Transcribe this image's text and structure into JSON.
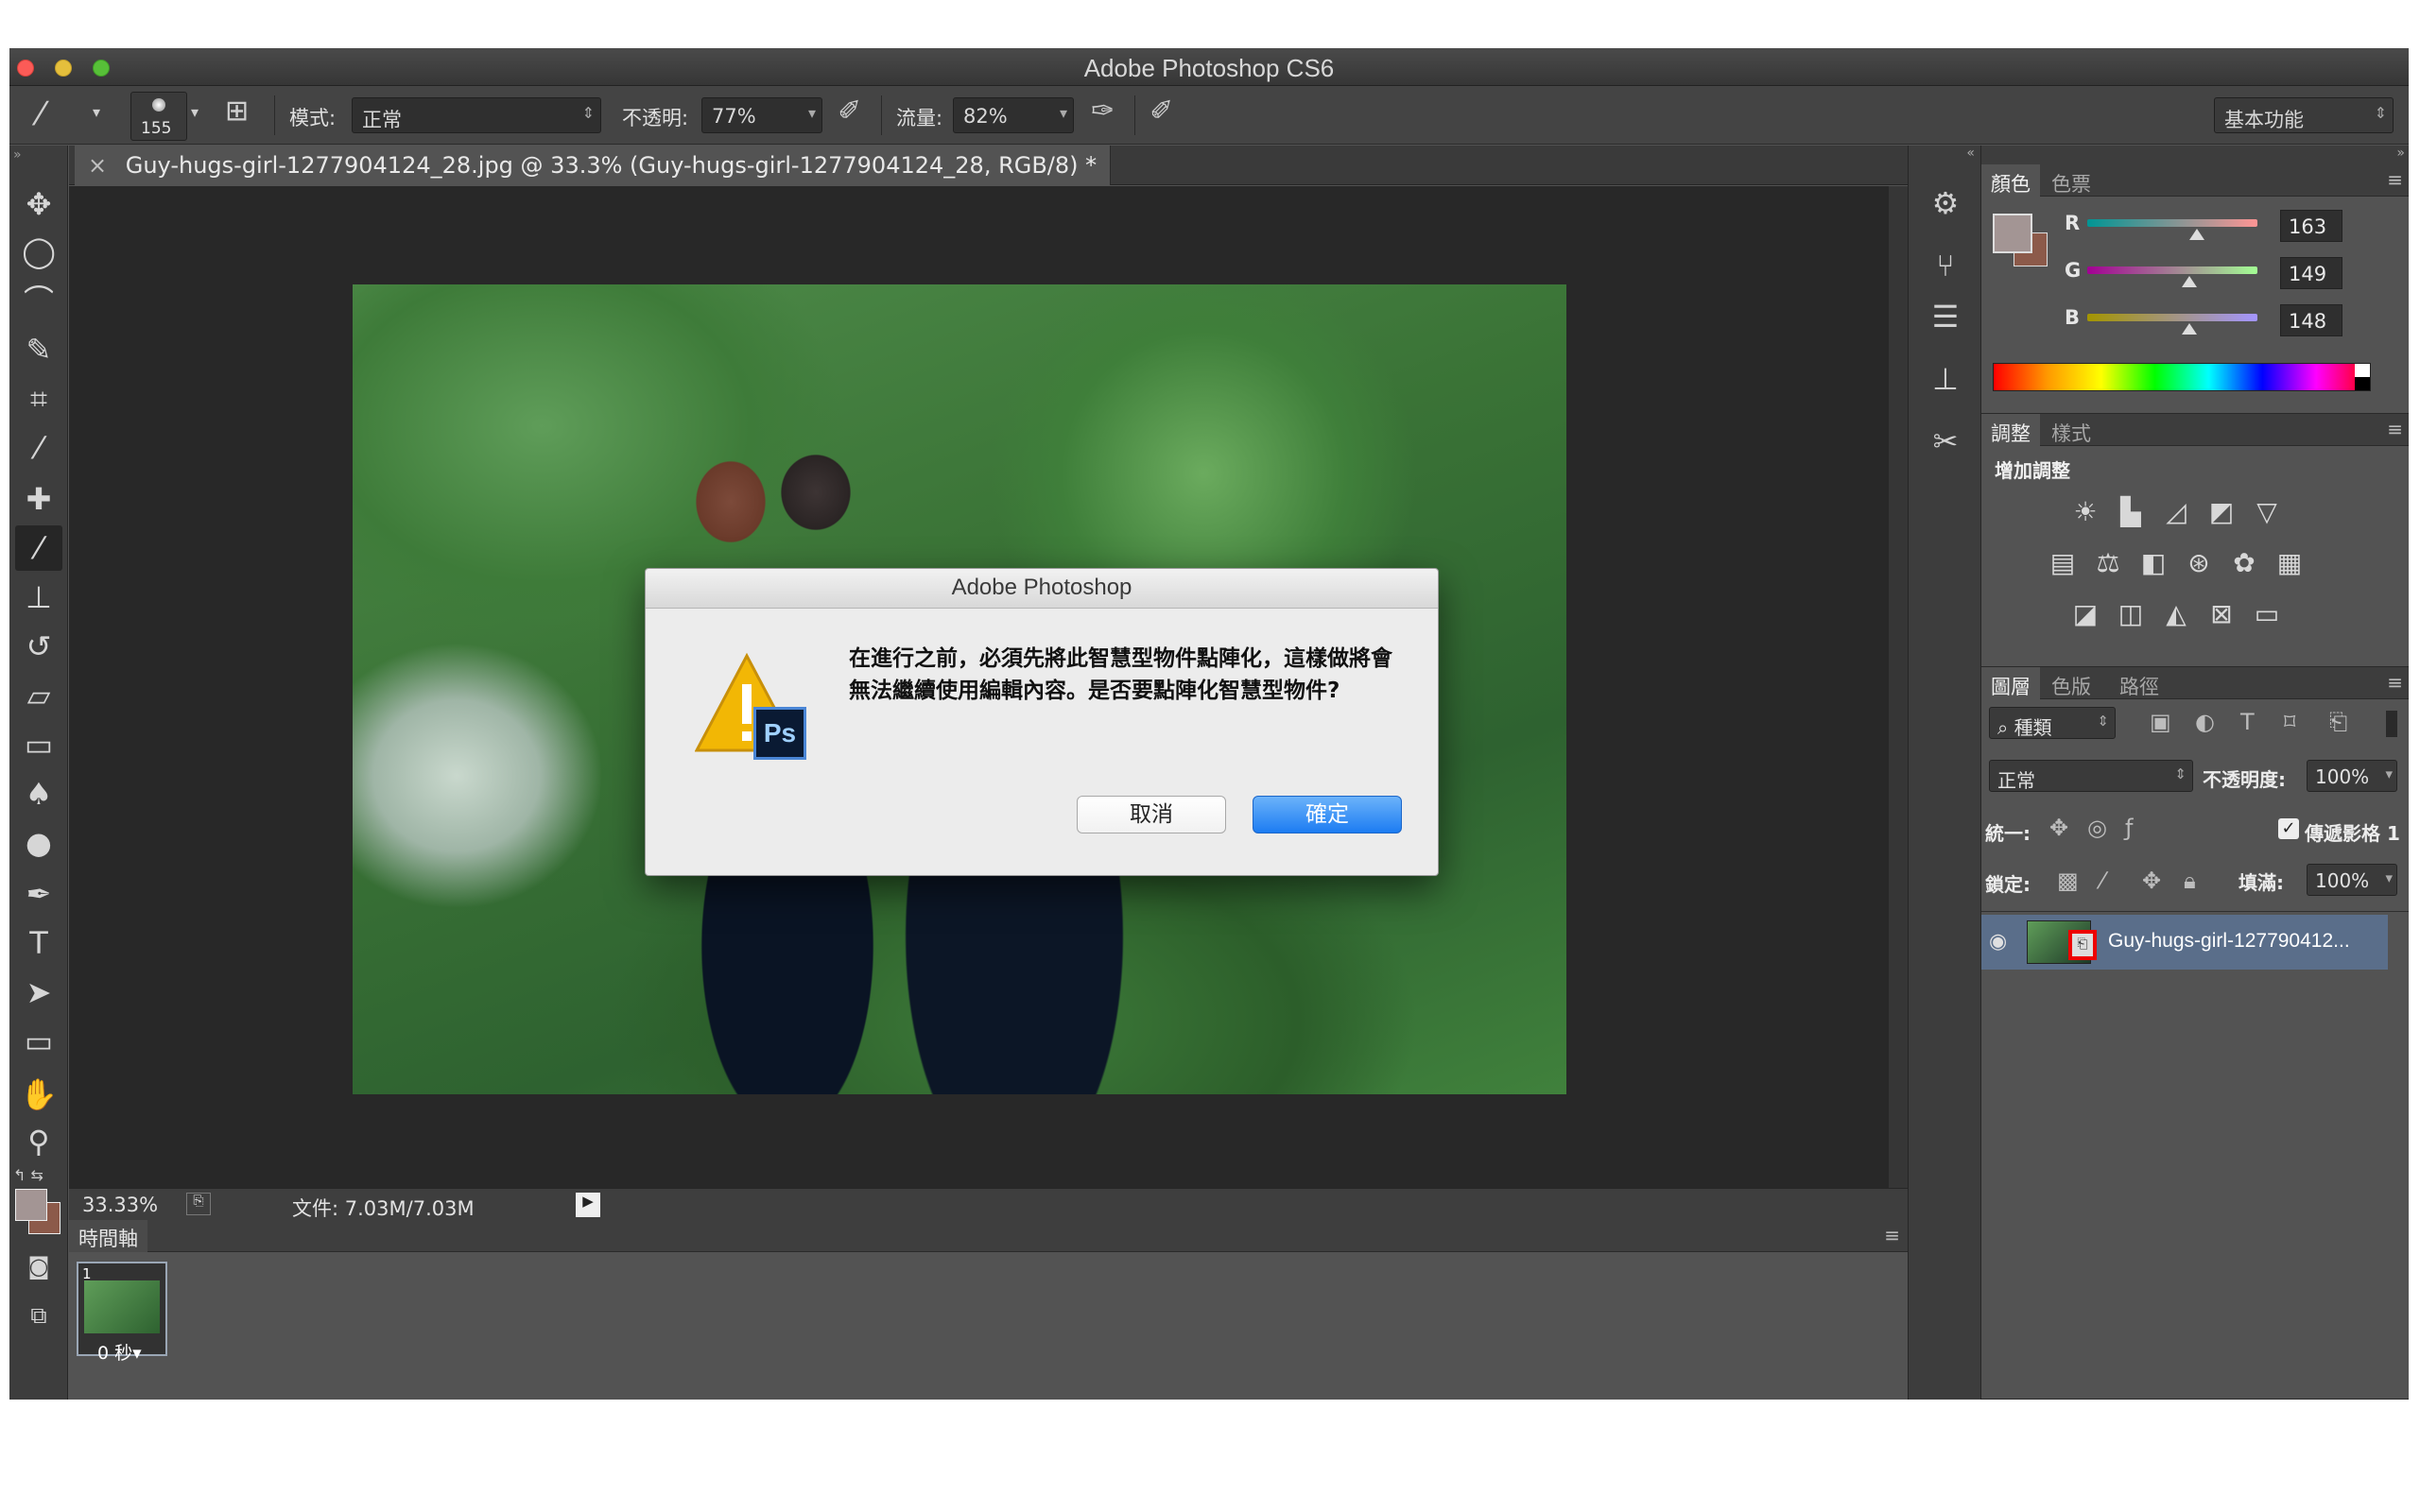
{
  "window": {
    "title": "Adobe Photoshop CS6"
  },
  "options_bar": {
    "brush_size": "155",
    "mode_label": "模式:",
    "mode_value": "正常",
    "opacity_label": "不透明:",
    "opacity_value": "77%",
    "flow_label": "流量:",
    "flow_value": "82%",
    "workspace": "基本功能"
  },
  "document": {
    "tab_title": "Guy-hugs-girl-1277904124_28.jpg @ 33.3% (Guy-hugs-girl-1277904124_28, RGB/8) *",
    "close_glyph": "×"
  },
  "status": {
    "zoom": "33.33%",
    "doc_info": "文件: 7.03M/7.03M"
  },
  "timeline": {
    "tab": "時間軸",
    "frame_number": "1",
    "frame_delay": "0 秒▾"
  },
  "color_panel": {
    "tabs": [
      "顏色",
      "色票"
    ],
    "r_label": "R",
    "r_value": "163",
    "g_label": "G",
    "g_value": "149",
    "b_label": "B",
    "b_value": "148",
    "foreground_color": "#a39594",
    "background_color": "#8c5a4a"
  },
  "adjustments_panel": {
    "tabs": [
      "調整",
      "樣式"
    ],
    "heading": "增加調整"
  },
  "layers_panel": {
    "tabs": [
      "圖層",
      "色版",
      "路徑"
    ],
    "filter_kind": "種類",
    "blend_mode": "正常",
    "opacity_label": "不透明度:",
    "opacity_value": "100%",
    "unify_label": "統一:",
    "propagate_label": "傳遞影格 1",
    "lock_label": "鎖定:",
    "fill_label": "填滿:",
    "fill_value": "100%",
    "layer_name": "Guy-hugs-girl-127790412..."
  },
  "dialog": {
    "title": "Adobe Photoshop",
    "message": "在進行之前，必須先將此智慧型物件點陣化，這樣做將會無法繼續使用編輯內容。是否要點陣化智慧型物件?",
    "cancel_label": "取消",
    "ok_label": "確定",
    "ps_badge": "Ps"
  }
}
